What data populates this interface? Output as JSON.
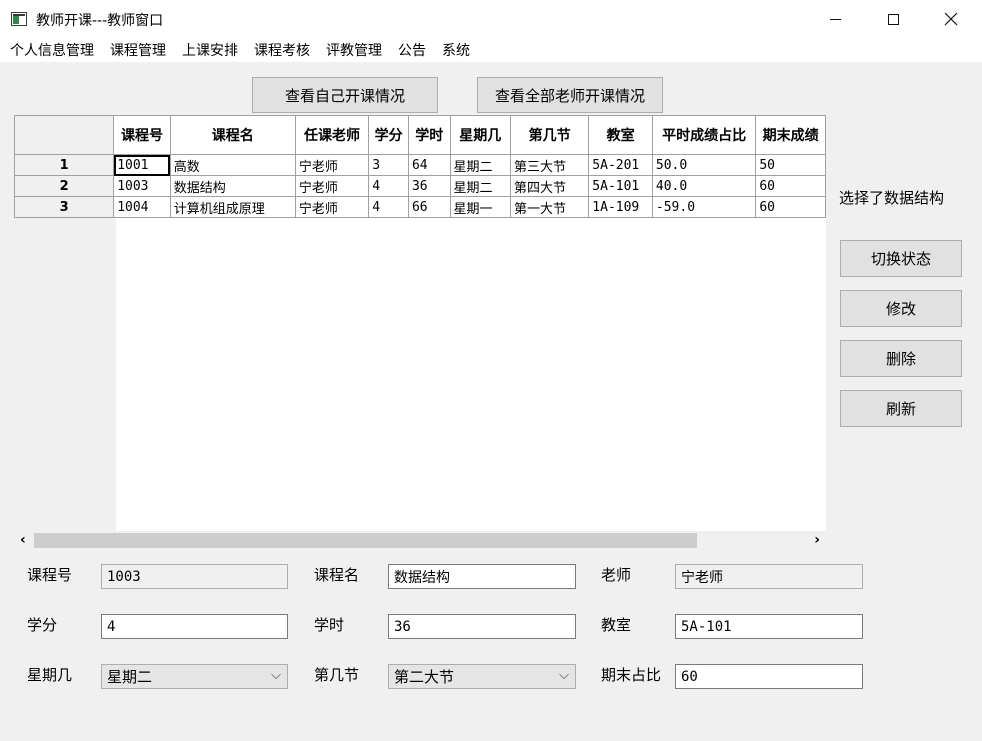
{
  "window": {
    "title": "教师开课---教师窗口"
  },
  "menu": [
    "个人信息管理",
    "课程管理",
    "上课安排",
    "课程考核",
    "评教管理",
    "公告",
    "系统"
  ],
  "buttons": {
    "view_own": "查看自己开课情况",
    "view_all": "查看全部老师开课情况",
    "toggle_state": "切换状态",
    "edit": "修改",
    "delete": "删除",
    "refresh": "刷新"
  },
  "status_text": "选择了数据结构",
  "table": {
    "columns": [
      "课程号",
      "课程名",
      "任课老师",
      "学分",
      "学时",
      "星期几",
      "第几节",
      "教室",
      "平时成绩占比",
      "期末成绩"
    ],
    "rows": [
      {
        "index": "1",
        "cells": [
          "1001",
          "高数",
          "宁老师",
          "3",
          "64",
          "星期二",
          "第三大节",
          "5A-201",
          "50.0",
          "50"
        ]
      },
      {
        "index": "2",
        "cells": [
          "1003",
          "数据结构",
          "宁老师",
          "4",
          "36",
          "星期二",
          "第四大节",
          "5A-101",
          "40.0",
          "60"
        ]
      },
      {
        "index": "3",
        "cells": [
          "1004",
          "计算机组成原理",
          "宁老师",
          "4",
          "66",
          "星期一",
          "第一大节",
          "1A-109",
          "-59.0",
          "60"
        ]
      }
    ]
  },
  "form": {
    "labels": {
      "course_id": "课程号",
      "course_name": "课程名",
      "teacher": "老师",
      "credit": "学分",
      "hours": "学时",
      "room": "教室",
      "weekday": "星期几",
      "period": "第几节",
      "final_ratio": "期末占比"
    },
    "values": {
      "course_id": "1003",
      "course_name": "数据结构",
      "teacher": "宁老师",
      "credit": "4",
      "hours": "36",
      "room": "5A-101",
      "weekday": "星期二",
      "period": "第二大节",
      "final_ratio": "60"
    }
  },
  "icons": {
    "scroll_left": "‹",
    "scroll_right": "›",
    "chevron": "⌵"
  }
}
